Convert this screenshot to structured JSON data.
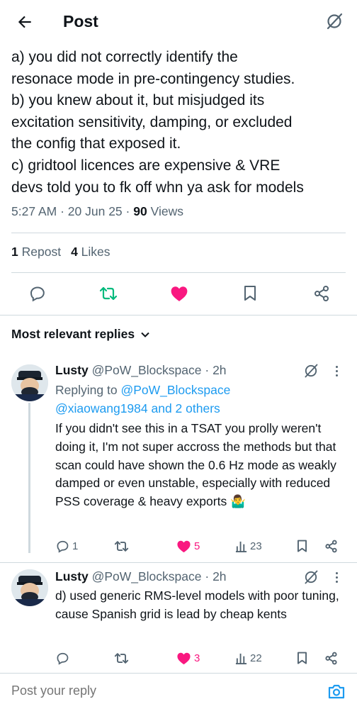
{
  "header": {
    "title": "Post"
  },
  "post": {
    "text": "a) you did not correctly identify the\nresonace mode in pre-contingency studies.\nb) you knew about it, but misjudged its\nexcitation sensitivity, damping, or excluded\nthe config that exposed it.\nc) gridtool licences are expensive &  VRE\ndevs told you to fk off whn ya ask for models",
    "time": "5:27 AM",
    "date": "20 Jun 25",
    "views_count": "90",
    "views_label": "Views",
    "reposts_count": "1",
    "reposts_label": "Repost",
    "likes_count": "4",
    "likes_label": "Likes"
  },
  "replies_sort": {
    "label": "Most relevant replies"
  },
  "replies": [
    {
      "name": "Lusty",
      "handle": "@PoW_Blockspace",
      "age": "2h",
      "replying_prefix": "Replying to",
      "replying_handle": "@PoW_Blockspace",
      "replying_rest": "@xiaowang1984 and 2 others",
      "text": "If you didn't see this in a TSAT you prolly weren't doing it, I'm not super accross the methods but that scan could have shown the 0.6 Hz mode as weakly damped or even unstable, especially with reduced PSS coverage & heavy exports 🤷‍♂️",
      "replies": "1",
      "reposts": "",
      "likes": "5",
      "views": "23"
    },
    {
      "name": "Lusty",
      "handle": "@PoW_Blockspace",
      "age": "2h",
      "text": "d) used generic RMS-level models with poor tuning, cause Spanish grid is lead by cheap kents",
      "replies": "",
      "reposts": "",
      "likes": "3",
      "views": "22"
    }
  ],
  "compose": {
    "placeholder": "Post your reply"
  },
  "colors": {
    "like": "#f91880",
    "repost": "#00ba7c",
    "link": "#1d9bf0",
    "muted": "#536471"
  },
  "icons": [
    "back-arrow-icon",
    "grok-icon",
    "reply-icon",
    "repost-icon",
    "like-icon",
    "bookmark-icon",
    "share-icon",
    "views-icon",
    "chevron-down-icon",
    "more-icon",
    "camera-icon"
  ]
}
